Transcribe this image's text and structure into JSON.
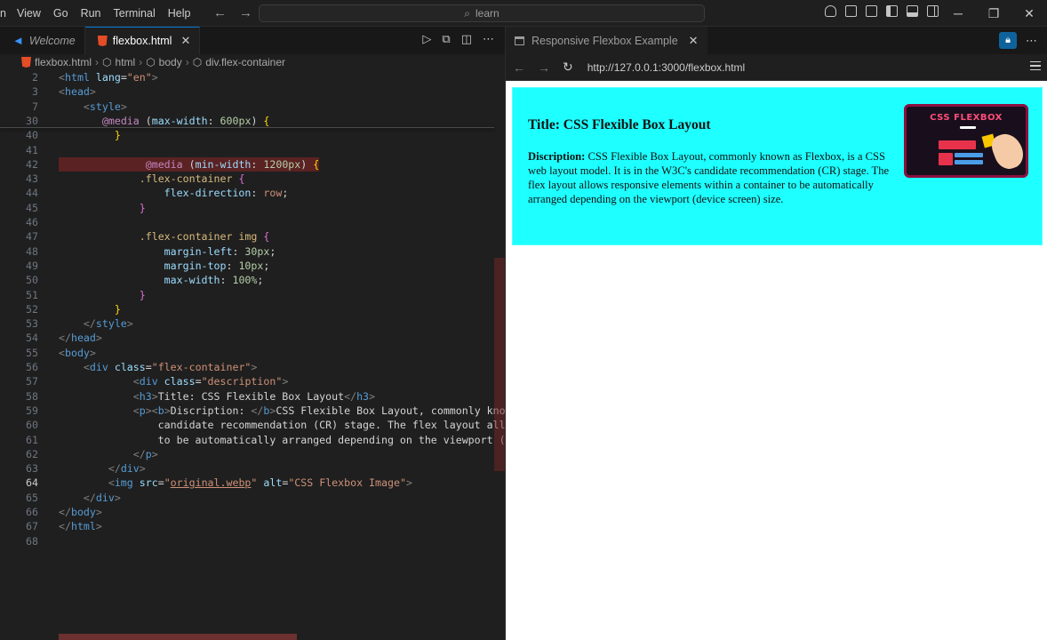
{
  "menu": [
    "n",
    "View",
    "Go",
    "Run",
    "Terminal",
    "Help"
  ],
  "search": {
    "text": "learn"
  },
  "editor": {
    "tabs": [
      {
        "label": "Welcome",
        "active": false
      },
      {
        "label": "flexbox.html",
        "active": true
      }
    ],
    "breadcrumb": [
      "flexbox.html",
      "html",
      "body",
      "div.flex-container"
    ],
    "lines": [
      {
        "n": "2",
        "segments": [
          [
            "t-br",
            "<"
          ],
          [
            "t-tag",
            "html"
          ],
          [
            "t-attr",
            " lang"
          ],
          [
            "t-txt",
            "="
          ],
          [
            "t-str",
            "\"en\""
          ],
          [
            "t-br",
            ">"
          ]
        ]
      },
      {
        "n": "3",
        "segments": [
          [
            "t-br",
            "<"
          ],
          [
            "t-tag",
            "head"
          ],
          [
            "t-br",
            ">"
          ]
        ]
      },
      {
        "n": "7",
        "segments": [
          [
            "t-txt",
            "    "
          ],
          [
            "t-br",
            "<"
          ],
          [
            "t-tag",
            "style"
          ],
          [
            "t-br",
            ">"
          ]
        ]
      },
      {
        "n": "30",
        "segments": [
          [
            "t-txt",
            "       "
          ],
          [
            "t-kw",
            "@media"
          ],
          [
            "t-txt",
            " ("
          ],
          [
            "t-prop",
            "max-width"
          ],
          [
            "t-txt",
            ": "
          ],
          [
            "t-num",
            "600px"
          ],
          [
            "t-txt",
            ") "
          ],
          [
            "t-y",
            "{"
          ]
        ]
      },
      {
        "n": "40",
        "segments": [
          [
            "t-txt",
            "         "
          ],
          [
            "t-y",
            "}"
          ]
        ]
      },
      {
        "n": "41",
        "segments": [
          [
            "t-txt",
            ""
          ]
        ]
      },
      {
        "n": "42",
        "segments": [
          [
            "t-txt",
            "              "
          ],
          [
            "t-kw",
            "@media"
          ],
          [
            "t-txt",
            " ("
          ],
          [
            "t-prop",
            "min-width"
          ],
          [
            "t-txt",
            ": "
          ],
          [
            "t-num",
            "1200px"
          ],
          [
            "t-txt",
            ") "
          ],
          [
            "t-y",
            "{"
          ]
        ]
      },
      {
        "n": "43",
        "segments": [
          [
            "t-txt",
            "             "
          ],
          [
            "t-sel",
            ".flex-container"
          ],
          [
            "t-txt",
            " "
          ],
          [
            "t-p",
            "{"
          ]
        ]
      },
      {
        "n": "44",
        "segments": [
          [
            "t-txt",
            "                 "
          ],
          [
            "t-prop",
            "flex-direction"
          ],
          [
            "t-txt",
            ": "
          ],
          [
            "t-str",
            "row"
          ],
          [
            "t-txt",
            ";"
          ]
        ]
      },
      {
        "n": "45",
        "segments": [
          [
            "t-txt",
            "             "
          ],
          [
            "t-p",
            "}"
          ]
        ]
      },
      {
        "n": "46",
        "segments": [
          [
            "t-txt",
            ""
          ]
        ]
      },
      {
        "n": "47",
        "segments": [
          [
            "t-txt",
            "             "
          ],
          [
            "t-sel",
            ".flex-container img"
          ],
          [
            "t-txt",
            " "
          ],
          [
            "t-p",
            "{"
          ]
        ]
      },
      {
        "n": "48",
        "segments": [
          [
            "t-txt",
            "                 "
          ],
          [
            "t-prop",
            "margin-left"
          ],
          [
            "t-txt",
            ": "
          ],
          [
            "t-num",
            "30px"
          ],
          [
            "t-txt",
            ";"
          ]
        ]
      },
      {
        "n": "49",
        "segments": [
          [
            "t-txt",
            "                 "
          ],
          [
            "t-prop",
            "margin-top"
          ],
          [
            "t-txt",
            ": "
          ],
          [
            "t-num",
            "10px"
          ],
          [
            "t-txt",
            ";"
          ]
        ]
      },
      {
        "n": "50",
        "segments": [
          [
            "t-txt",
            "                 "
          ],
          [
            "t-prop",
            "max-width"
          ],
          [
            "t-txt",
            ": "
          ],
          [
            "t-num",
            "100%"
          ],
          [
            "t-txt",
            ";"
          ]
        ]
      },
      {
        "n": "51",
        "segments": [
          [
            "t-txt",
            "             "
          ],
          [
            "t-p",
            "}"
          ]
        ]
      },
      {
        "n": "52",
        "segments": [
          [
            "t-txt",
            "         "
          ],
          [
            "t-y",
            "}"
          ]
        ]
      },
      {
        "n": "53",
        "segments": [
          [
            "t-txt",
            "    "
          ],
          [
            "t-br",
            "</"
          ],
          [
            "t-tag",
            "style"
          ],
          [
            "t-br",
            ">"
          ]
        ]
      },
      {
        "n": "54",
        "segments": [
          [
            "t-br",
            "</"
          ],
          [
            "t-tag",
            "head"
          ],
          [
            "t-br",
            ">"
          ]
        ]
      },
      {
        "n": "55",
        "segments": [
          [
            "t-br",
            "<"
          ],
          [
            "t-tag",
            "body"
          ],
          [
            "t-br",
            ">"
          ]
        ]
      },
      {
        "n": "56",
        "segments": [
          [
            "t-txt",
            "    "
          ],
          [
            "t-br",
            "<"
          ],
          [
            "t-tag",
            "div"
          ],
          [
            "t-attr",
            " class"
          ],
          [
            "t-txt",
            "="
          ],
          [
            "t-str",
            "\"flex-container\""
          ],
          [
            "t-br",
            ">"
          ]
        ]
      },
      {
        "n": "57",
        "segments": [
          [
            "t-txt",
            "            "
          ],
          [
            "t-br",
            "<"
          ],
          [
            "t-tag",
            "div"
          ],
          [
            "t-attr",
            " class"
          ],
          [
            "t-txt",
            "="
          ],
          [
            "t-str",
            "\"description\""
          ],
          [
            "t-br",
            ">"
          ]
        ]
      },
      {
        "n": "58",
        "segments": [
          [
            "t-txt",
            "            "
          ],
          [
            "t-br",
            "<"
          ],
          [
            "t-tag",
            "h3"
          ],
          [
            "t-br",
            ">"
          ],
          [
            "t-txt",
            "Title: CSS Flexible Box Layout"
          ],
          [
            "t-br",
            "</"
          ],
          [
            "t-tag",
            "h3"
          ],
          [
            "t-br",
            ">"
          ]
        ]
      },
      {
        "n": "59",
        "segments": [
          [
            "t-txt",
            "            "
          ],
          [
            "t-br",
            "<"
          ],
          [
            "t-tag",
            "p"
          ],
          [
            "t-br",
            "><"
          ],
          [
            "t-tag",
            "b"
          ],
          [
            "t-br",
            ">"
          ],
          [
            "t-txt",
            "Discription: "
          ],
          [
            "t-br",
            "</"
          ],
          [
            "t-tag",
            "b"
          ],
          [
            "t-br",
            ">"
          ],
          [
            "t-txt",
            "CSS Flexible Box Layout, commonly known a"
          ]
        ]
      },
      {
        "n": "60",
        "segments": [
          [
            "t-txt",
            "                candidate recommendation (CR) stage. The flex layout allows"
          ]
        ]
      },
      {
        "n": "61",
        "segments": [
          [
            "t-txt",
            "                to be automatically arranged depending on the viewport (devi"
          ]
        ]
      },
      {
        "n": "62",
        "segments": [
          [
            "t-txt",
            "            "
          ],
          [
            "t-br",
            "</"
          ],
          [
            "t-tag",
            "p"
          ],
          [
            "t-br",
            ">"
          ]
        ]
      },
      {
        "n": "63",
        "segments": [
          [
            "t-txt",
            "        "
          ],
          [
            "t-br",
            "</"
          ],
          [
            "t-tag",
            "div"
          ],
          [
            "t-br",
            ">"
          ]
        ]
      },
      {
        "n": "64",
        "segments": [
          [
            "t-txt",
            "        "
          ],
          [
            "t-br",
            "<"
          ],
          [
            "t-tag",
            "img"
          ],
          [
            "t-attr",
            " src"
          ],
          [
            "t-txt",
            "="
          ],
          [
            "t-str",
            "\""
          ],
          [
            "t-link",
            "original.webp"
          ],
          [
            "t-str",
            "\""
          ],
          [
            "t-attr",
            " alt"
          ],
          [
            "t-txt",
            "="
          ],
          [
            "t-str",
            "\"CSS Flexbox Image\""
          ],
          [
            "t-br",
            ">"
          ]
        ]
      },
      {
        "n": "65",
        "segments": [
          [
            "t-txt",
            "    "
          ],
          [
            "t-br",
            "</"
          ],
          [
            "t-tag",
            "div"
          ],
          [
            "t-br",
            ">"
          ]
        ]
      },
      {
        "n": "66",
        "segments": [
          [
            "t-br",
            "</"
          ],
          [
            "t-tag",
            "body"
          ],
          [
            "t-br",
            ">"
          ]
        ]
      },
      {
        "n": "67",
        "segments": [
          [
            "t-br",
            "</"
          ],
          [
            "t-tag",
            "html"
          ],
          [
            "t-br",
            ">"
          ]
        ]
      },
      {
        "n": "68",
        "segments": [
          [
            "t-txt",
            ""
          ]
        ]
      }
    ]
  },
  "preview": {
    "tab_label": "Responsive Flexbox Example",
    "url": "http://127.0.0.1:3000/flexbox.html",
    "heading": "Title: CSS Flexible Box Layout",
    "description_label": "Discription:",
    "description_text": " CSS Flexible Box Layout, commonly known as Flexbox, is a CSS web layout model. It is in the W3C's candidate recommendation (CR) stage. The flex layout allows responsive elements within a container to be automatically arranged depending on the viewport (device screen) size.",
    "image_text": "CSS FLEXBOX",
    "box_color": "#1effff"
  },
  "colors": {
    "accent": "#0078d4",
    "error": "#c82828"
  }
}
